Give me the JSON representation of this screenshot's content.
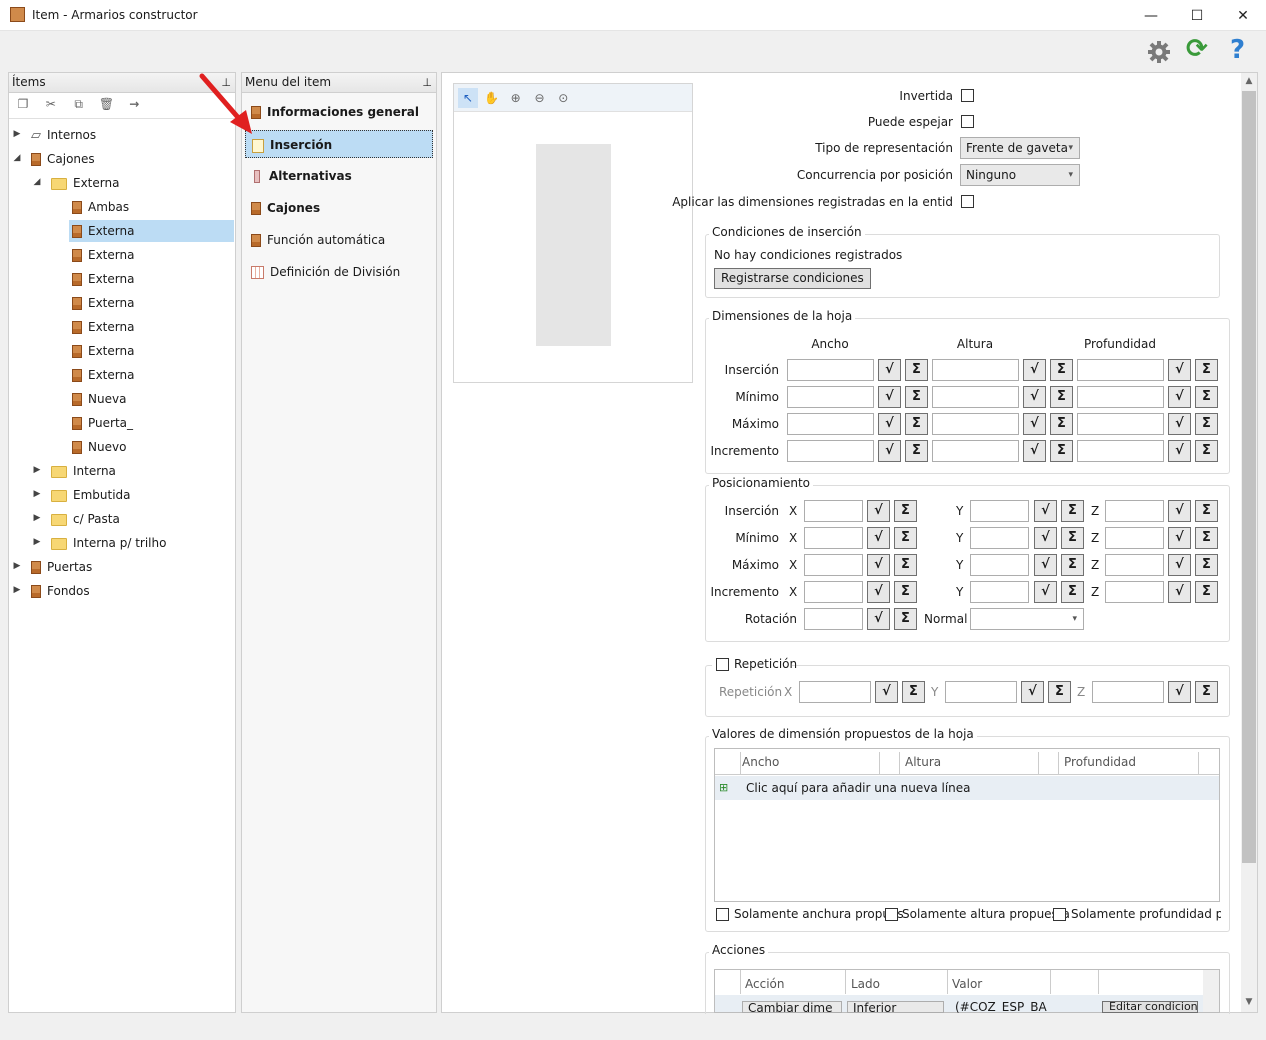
{
  "window": {
    "title": "Item - Armarios constructor",
    "minimize": "—",
    "maximize": "☐",
    "close": "✕"
  },
  "toolbar": {
    "settings_icon": "gear-icon",
    "refresh_icon": "refresh-icon",
    "help_icon": "help-icon",
    "help_glyph": "?",
    "refresh_glyph": "⟳"
  },
  "items_panel": {
    "title": "Ítems",
    "pin": "⊥",
    "tree": [
      {
        "label": "Internos",
        "level": 0,
        "expander": "▶"
      },
      {
        "label": "Cajones",
        "level": 0,
        "expander": "◢"
      },
      {
        "label": "Externa",
        "level": 1,
        "expander": "◢"
      },
      {
        "label": "Ambas",
        "level": 2
      },
      {
        "label": "Externa",
        "level": 2,
        "selected": true
      },
      {
        "label": "Externa",
        "level": 2
      },
      {
        "label": "Externa",
        "level": 2
      },
      {
        "label": "Externa",
        "level": 2
      },
      {
        "label": "Externa",
        "level": 2
      },
      {
        "label": "Externa",
        "level": 2
      },
      {
        "label": "Externa",
        "level": 2
      },
      {
        "label": "Nueva",
        "level": 2
      },
      {
        "label": "Puerta_",
        "level": 2
      },
      {
        "label": "Nuevo",
        "level": 2
      },
      {
        "label": "Interna",
        "level": 1,
        "expander": "▶"
      },
      {
        "label": "Embutida",
        "level": 1,
        "expander": "▶"
      },
      {
        "label": "c/ Pasta",
        "level": 1,
        "expander": "▶"
      },
      {
        "label": "Interna p/ trilho",
        "level": 1,
        "expander": "▶"
      },
      {
        "label": "Puertas",
        "level": 0,
        "expander": "▶"
      },
      {
        "label": "Fondos",
        "level": 0,
        "expander": "▶"
      }
    ]
  },
  "menu_panel": {
    "title": "Menu del item",
    "pin": "⊥",
    "items": [
      {
        "label": "Informaciones general",
        "bold": true
      },
      {
        "label": "Inserción",
        "bold": true,
        "selected": true
      },
      {
        "label": "Alternativas",
        "bold": true
      },
      {
        "label": "Cajones",
        "bold": true
      },
      {
        "label": "Función automática",
        "bold": false
      },
      {
        "label": "Definición de División",
        "bold": false
      }
    ]
  },
  "props": {
    "invertida": "Invertida",
    "puede_espejar": "Puede espejar",
    "tipo_rep_label": "Tipo de representación",
    "tipo_rep_value": "Frente de gaveta",
    "concurrencia_label": "Concurrencia por posición",
    "concurrencia_value": "Ninguno",
    "aplicar_label": "Aplicar las dimensiones registradas en la entid",
    "cond_title": "Condiciones de inserción",
    "cond_none": "No hay condiciones registrados",
    "cond_button": "Registrarse condiciones",
    "dims_title": "Dimensiones de la hoja",
    "col_ancho": "Ancho",
    "col_altura": "Altura",
    "col_prof": "Profundidad",
    "row_insercion": "Inserción",
    "row_minimo": "Mínimo",
    "row_maximo": "Máximo",
    "row_incremento": "Incremento",
    "pos_title": "Posicionamiento",
    "x": "X",
    "y": "Y",
    "z": "Z",
    "rotacion": "Rotación",
    "normal": "Normal",
    "repeticion_check": "Repetición",
    "repeticion_label": "Repetición",
    "valores_title": "Valores de dimensión propuestos de la hoja",
    "add_line": "Clic aquí para añadir una nueva línea",
    "solo_ancho": "Solamente anchura propues",
    "solo_altura": "Solamente altura propuesta",
    "solo_prof": "Solamente profundidad pro|",
    "acciones_title": "Acciones",
    "accion_col": "Acción",
    "lado_col": "Lado",
    "valor_col": "Valor",
    "accion_val": "Cambiar dime",
    "lado_val": "Inferior",
    "valor_val": "(#COZ_ESP_BAS#",
    "editar_btn": "Editar condiciones",
    "sqrt_glyph": "√",
    "sigma_glyph": "Σ",
    "dd_glyph": "▾"
  }
}
